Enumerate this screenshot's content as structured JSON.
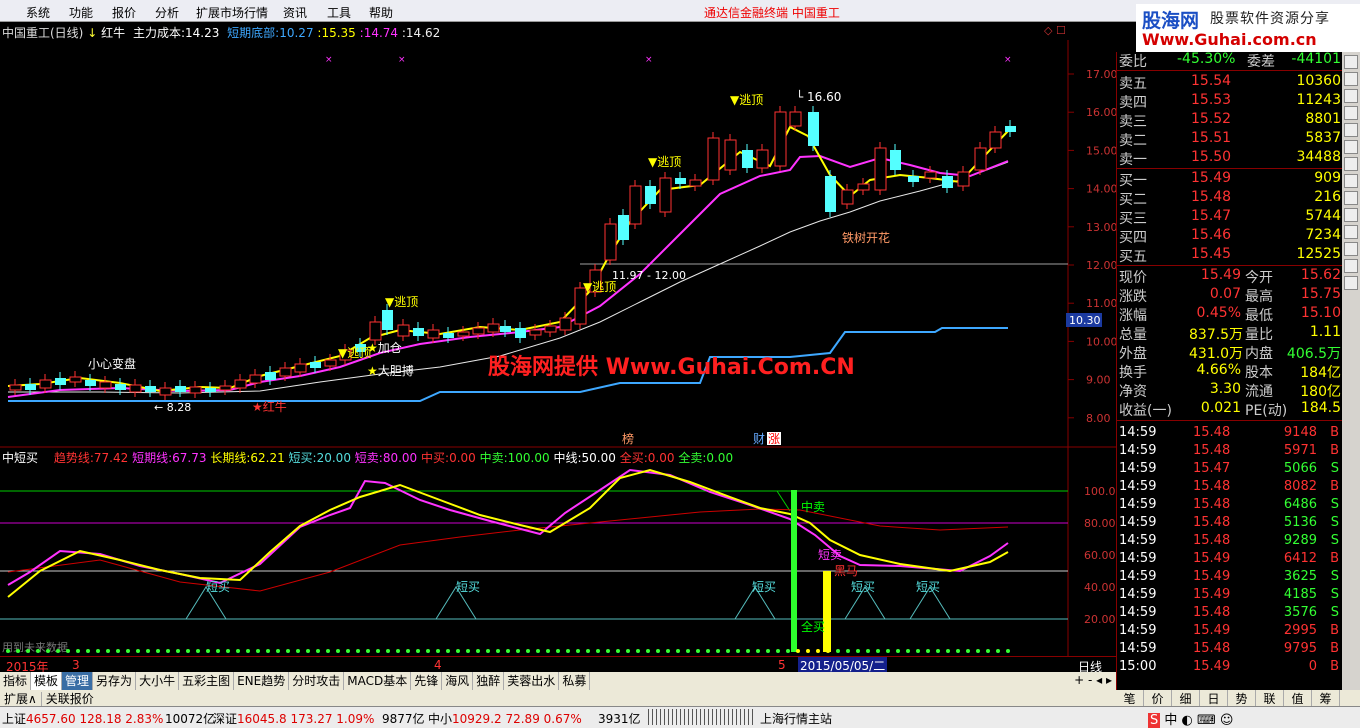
{
  "menu": [
    "系统",
    "功能",
    "报价",
    "分析",
    "扩展市场行情",
    "资讯",
    "工具",
    "帮助"
  ],
  "center_title": "通达信金融终端   中国重工",
  "logo": {
    "l1": "股海网",
    "l2": "股票软件资源分享",
    "l3": "Www.Guhai.com.cn"
  },
  "main_info": {
    "name": "中国重工(日线)",
    "hongniu": "红牛",
    "zlcb_label": "主力成本:",
    "zlcb": "14.23",
    "dqdb_label": "短期底部:",
    "dqdb": "10.27",
    "v1": "15.35",
    "v2": "14.74",
    "v3": "14.62"
  },
  "watermark": "股海网提供 Www.Guhai.Com.CN",
  "price_axis": [
    "17.00",
    "16.00",
    "15.00",
    "14.00",
    "13.00",
    "12.00",
    "11.00",
    "10.00",
    "9.00",
    "8.00"
  ],
  "price_marker": "10.30",
  "annotations": {
    "xiaoxin": "小心变盘",
    "escape": "逃顶",
    "jiacang": "加仓",
    "dadan": "大胆搏",
    "hongniu": "红牛",
    "tieshu": "铁树开花",
    "high": "16.60",
    "low": "8.28",
    "mid": "11.97 - 12.00",
    "bang": "榜",
    "cai": "财",
    "zhang": "涨"
  },
  "ind_info": {
    "name": "中短买",
    "qsx_label": "趋势线:",
    "qsx": "77.42",
    "dqx_label": "短期线:",
    "dqx": "67.73",
    "cqx_label": "长期线:",
    "cqx": "62.21",
    "dm_label": "短买:",
    "dm": "20.00",
    "dmai_label": "短卖:",
    "dmai": "80.00",
    "zm_label": "中买:",
    "zm": "0.00",
    "zmai_label": "中卖:",
    "zmai": "100.00",
    "zx_label": "中线:",
    "zx": "50.00",
    "qm_label": "全买:",
    "qm": "0.00",
    "qmai_label": "全卖:",
    "qmai": "0.00"
  },
  "ind_axis": [
    "100.0",
    "80.00",
    "60.00",
    "40.00",
    "20.00"
  ],
  "ind_labels": {
    "zhongmai": "中卖",
    "duanmai": "短卖",
    "heima": "黑马",
    "duanmai2": "短买",
    "quanmai": "全买",
    "future": "用到未来数据"
  },
  "xaxis": {
    "year": "2015年",
    "m3": "3",
    "m4": "4",
    "m5": "5",
    "date": "2015/05/05/二",
    "period": "日线"
  },
  "tabs": [
    "指标",
    "模板",
    "管理",
    "另存为",
    "大小牛",
    "五彩主图",
    "ENE趋势",
    "分时攻击",
    "MACD基本",
    "先锋",
    "海风",
    "独醉",
    "芙蓉出水",
    "私募"
  ],
  "tabs2": [
    "扩展∧",
    "关联报价"
  ],
  "orderbook": {
    "wb": {
      "label": "委比",
      "pct": "-45.30%",
      "label2": "委差",
      "val": "-44101"
    },
    "asks": [
      {
        "l": "卖五",
        "p": "15.54",
        "v": "10360"
      },
      {
        "l": "卖四",
        "p": "15.53",
        "v": "11243"
      },
      {
        "l": "卖三",
        "p": "15.52",
        "v": "8801"
      },
      {
        "l": "卖二",
        "p": "15.51",
        "v": "5837"
      },
      {
        "l": "卖一",
        "p": "15.50",
        "v": "34488"
      }
    ],
    "bids": [
      {
        "l": "买一",
        "p": "15.49",
        "v": "909"
      },
      {
        "l": "买二",
        "p": "15.48",
        "v": "216"
      },
      {
        "l": "买三",
        "p": "15.47",
        "v": "5744"
      },
      {
        "l": "买四",
        "p": "15.46",
        "v": "7234"
      },
      {
        "l": "买五",
        "p": "15.45",
        "v": "12525"
      }
    ]
  },
  "stats": [
    {
      "a": "现价",
      "av": "15.49",
      "b": "今开",
      "bv": "15.62"
    },
    {
      "a": "涨跌",
      "av": "0.07",
      "b": "最高",
      "bv": "15.75"
    },
    {
      "a": "涨幅",
      "av": "0.45%",
      "b": "最低",
      "bv": "15.10"
    },
    {
      "a": "总量",
      "av": "837.5万",
      "b": "量比",
      "bv": "1.11"
    },
    {
      "a": "外盘",
      "av": "431.0万",
      "b": "内盘",
      "bv": "406.5万"
    },
    {
      "a": "换手",
      "av": "4.66%",
      "b": "股本",
      "bv": "184亿"
    },
    {
      "a": "净资",
      "av": "3.30",
      "b": "流通",
      "bv": "180亿"
    },
    {
      "a": "收益(一)",
      "av": "0.021",
      "b": "PE(动)",
      "bv": "184.5"
    }
  ],
  "ticks": [
    {
      "t": "14:59",
      "p": "15.48",
      "v": "9148",
      "s": "B"
    },
    {
      "t": "14:59",
      "p": "15.48",
      "v": "5971",
      "s": "B"
    },
    {
      "t": "14:59",
      "p": "15.47",
      "v": "5066",
      "s": "S"
    },
    {
      "t": "14:59",
      "p": "15.48",
      "v": "8082",
      "s": "B"
    },
    {
      "t": "14:59",
      "p": "15.48",
      "v": "6486",
      "s": "S"
    },
    {
      "t": "14:59",
      "p": "15.48",
      "v": "5136",
      "s": "S"
    },
    {
      "t": "14:59",
      "p": "15.48",
      "v": "9289",
      "s": "S"
    },
    {
      "t": "14:59",
      "p": "15.49",
      "v": "6412",
      "s": "B"
    },
    {
      "t": "14:59",
      "p": "15.49",
      "v": "3625",
      "s": "S"
    },
    {
      "t": "14:59",
      "p": "15.49",
      "v": "4185",
      "s": "S"
    },
    {
      "t": "14:59",
      "p": "15.48",
      "v": "3576",
      "s": "S"
    },
    {
      "t": "14:59",
      "p": "15.49",
      "v": "2995",
      "s": "B"
    },
    {
      "t": "14:59",
      "p": "15.48",
      "v": "9795",
      "s": "B"
    },
    {
      "t": "15:00",
      "p": "15.49",
      "v": "0",
      "s": "B"
    }
  ],
  "rtabs": [
    "笔",
    "价",
    "细",
    "日",
    "势",
    "联",
    "值",
    "筹"
  ],
  "status": {
    "sh": "上证",
    "shv": "4657.60",
    "shc": "128.18",
    "shp": "2.83%",
    "sha": "10072亿",
    "sz": "深证",
    "szv": "16045.8",
    "szc": "173.27",
    "szp": "1.09%",
    "sza": "9877亿",
    "zx": "中小",
    "zxv": "10929.2",
    "zxc": "72.89",
    "zxp": "0.67%",
    "zxa": "3931亿",
    "site": "上海行情主站"
  },
  "colors": {
    "up": "#ff3232",
    "down": "#54ffff",
    "ma_fast": "#ffff00",
    "ma_mid": "#ff33ff",
    "ma_slow": "#e8e8e8",
    "support": "#3ea8ff",
    "grid": "#800000"
  }
}
